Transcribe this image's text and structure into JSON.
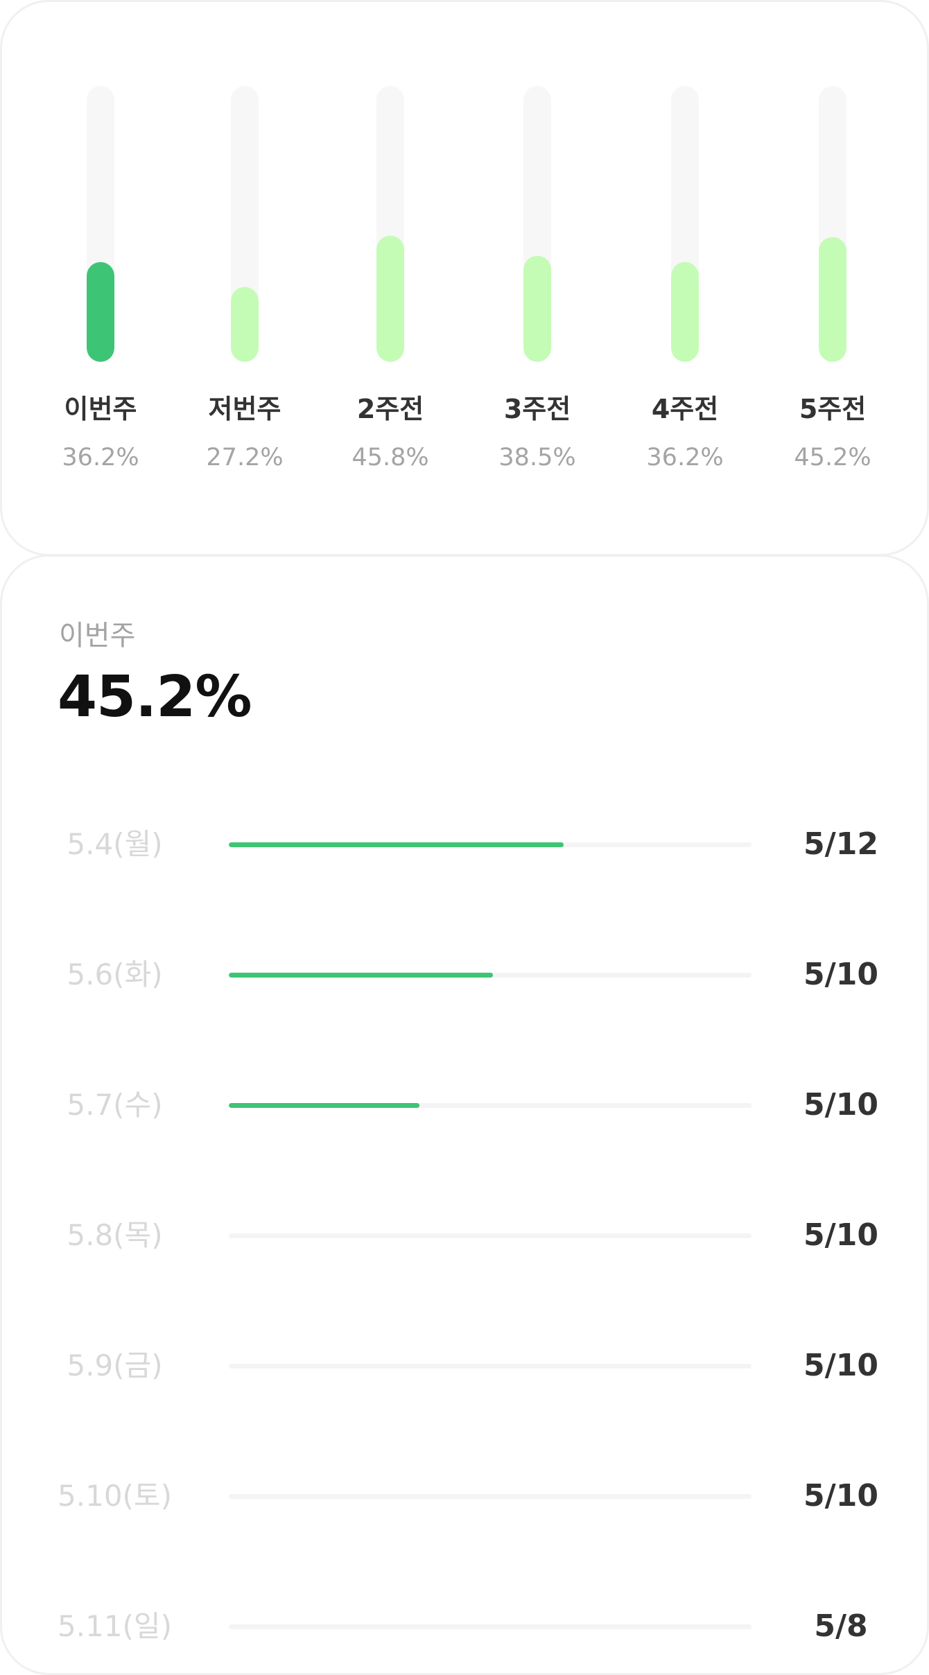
{
  "weekly": {
    "bars": [
      {
        "label": "이번주",
        "percent": "36.2%",
        "level": 0.362,
        "current": true
      },
      {
        "label": "저번주",
        "percent": "27.2%",
        "level": 0.272,
        "current": false
      },
      {
        "label": "2주전",
        "percent": "45.8%",
        "level": 0.458,
        "current": false
      },
      {
        "label": "3주전",
        "percent": "38.5%",
        "level": 0.385,
        "current": false
      },
      {
        "label": "4주전",
        "percent": "36.2%",
        "level": 0.362,
        "current": false
      },
      {
        "label": "5주전",
        "percent": "45.2%",
        "level": 0.452,
        "current": false
      }
    ],
    "colors": {
      "current": "#3ec475",
      "past": "#c4fcb6",
      "track": "#f6f7f6"
    }
  },
  "daily": {
    "caption": "이번주",
    "value": "45.2%",
    "rows": [
      {
        "date": "5.4(월)",
        "count": "5/12",
        "progress": 0.64
      },
      {
        "date": "5.6(화)",
        "count": "5/10",
        "progress": 0.505
      },
      {
        "date": "5.7(수)",
        "count": "5/10",
        "progress": 0.365
      },
      {
        "date": "5.8(목)",
        "count": "5/10",
        "progress": 0
      },
      {
        "date": "5.9(금)",
        "count": "5/10",
        "progress": 0
      },
      {
        "date": "5.10(토)",
        "count": "5/10",
        "progress": 0
      },
      {
        "date": "5.11(일)",
        "count": "5/8",
        "progress": 0
      }
    ],
    "colors": {
      "fill": "#3ec475",
      "track": "#f4f4f4"
    }
  }
}
